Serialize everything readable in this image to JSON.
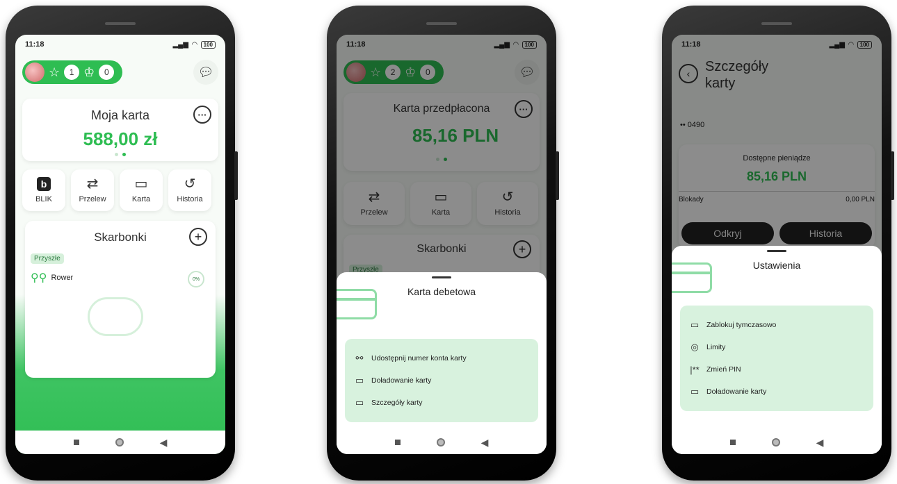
{
  "status_time": "11:18",
  "battery": "100",
  "phone1": {
    "stars": "1",
    "trophies": "0",
    "card_title": "Moja karta",
    "card_amount": "588,00 zł",
    "tiles": [
      {
        "icon": "blik-icon",
        "label": "BLIK"
      },
      {
        "icon": "transfer-icon",
        "label": "Przelew"
      },
      {
        "icon": "card-icon",
        "label": "Karta"
      },
      {
        "icon": "history-icon",
        "label": "Historia"
      }
    ],
    "savings_title": "Skarbonki",
    "savings_badge": "Przyszłe",
    "savings_item": "Rower",
    "savings_percent": "0%"
  },
  "phone2": {
    "stars": "2",
    "trophies": "0",
    "card_title": "Karta przedpłacona",
    "card_amount": "85,16 PLN",
    "tiles": [
      {
        "icon": "transfer-icon",
        "label": "Przelew"
      },
      {
        "icon": "card-icon",
        "label": "Karta"
      },
      {
        "icon": "history-icon",
        "label": "Historia"
      }
    ],
    "savings_title": "Skarbonki",
    "savings_badge": "Przyszłe",
    "sheet_title": "Karta debetowa",
    "menu": [
      {
        "icon": "share-icon",
        "label": "Udostępnij numer konta karty"
      },
      {
        "icon": "topup-icon",
        "label": "Doładowanie karty"
      },
      {
        "icon": "card-details-icon",
        "label": "Szczegóły karty"
      }
    ]
  },
  "phone3": {
    "title_line1": "Szczegóły",
    "title_line2": "karty",
    "card_number": "•• 0490",
    "available_label": "Dostępne pieniądze",
    "available_amount": "85,16 PLN",
    "blocked_label": "Blokady",
    "blocked_amount": "0,00 PLN",
    "btn_reveal": "Odkryj",
    "btn_history": "Historia",
    "sheet_title": "Ustawienia",
    "menu": [
      {
        "icon": "card-lock-icon",
        "label": "Zablokuj tymczasowo"
      },
      {
        "icon": "limits-icon",
        "label": "Limity"
      },
      {
        "icon": "pin-icon",
        "label": "Zmień PIN"
      },
      {
        "icon": "topup-icon",
        "label": "Doładowanie karty"
      }
    ]
  }
}
